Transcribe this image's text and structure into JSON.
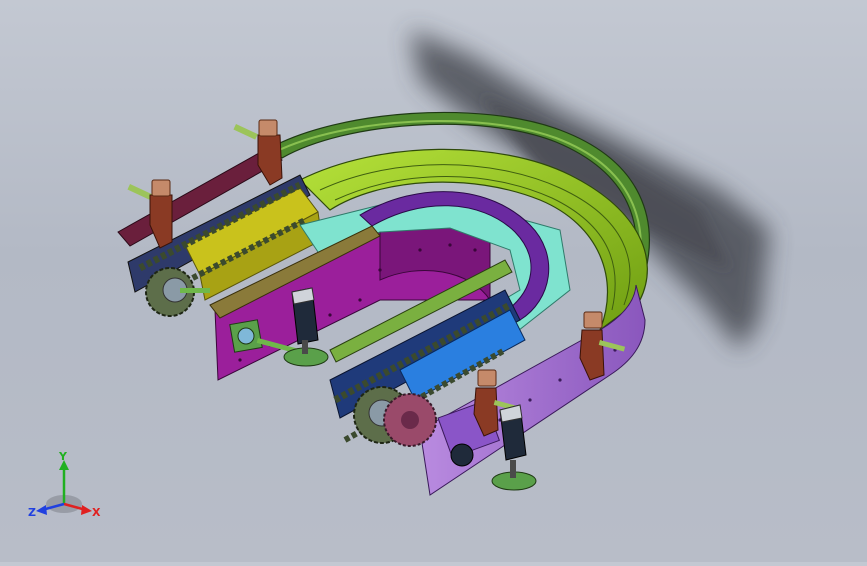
{
  "window": {
    "background_top": "#c3c8d2",
    "background_bottom": "#b8bdc8"
  },
  "model": {
    "description_icon": "conveyor-3d-model-icon",
    "colors": {
      "frame_magenta": "#9b1f9b",
      "frame_violet": "#9a5fc6",
      "rail_green": "#8fc21a",
      "guide_dark_green": "#3c6a2c",
      "chain_dark": "#3b4a2e",
      "blue_bar": "#2a7fe0",
      "yellow_block": "#c9c21c",
      "cyan_plate": "#7fe3cf",
      "maroon_bar": "#6a1f3c",
      "bracket_brown": "#8a3a24",
      "bolt_tan": "#c58a6a",
      "foot_green": "#5aa04a"
    }
  },
  "triad": {
    "x_label": "X",
    "y_label": "Y",
    "z_label": "Z",
    "x_color": "#e02020",
    "y_color": "#20b020",
    "z_color": "#2040e0"
  }
}
